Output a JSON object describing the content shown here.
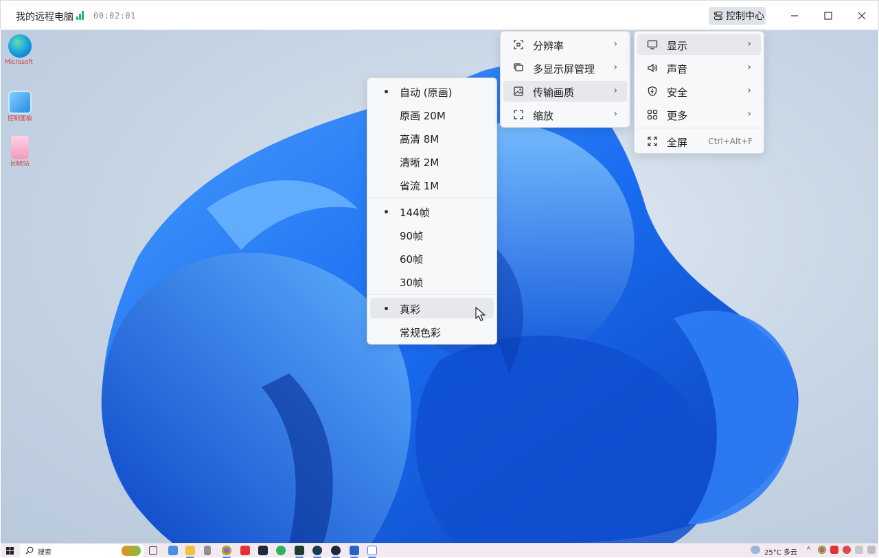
{
  "titlebar": {
    "title": "我的远程电脑",
    "timer": "00:02:01",
    "control_center": "控制中心"
  },
  "desktop_icons": [
    {
      "label": "Microsoft Edge",
      "icon": "edge-icon"
    },
    {
      "label": "控制面板",
      "icon": "control-panel-icon"
    },
    {
      "label": "回收站",
      "icon": "recycle-bin-icon"
    }
  ],
  "main_menu": {
    "items": [
      {
        "label": "显示",
        "icon": "monitor-icon"
      },
      {
        "label": "声音",
        "icon": "speaker-icon"
      },
      {
        "label": "安全",
        "icon": "shield-icon"
      },
      {
        "label": "更多",
        "icon": "grid-icon"
      },
      {
        "label": "全屏",
        "icon": "fullscreen-icon",
        "shortcut": "Ctrl+Alt+F"
      }
    ]
  },
  "display_menu": {
    "items": [
      {
        "label": "分辨率",
        "icon": "resolution-icon"
      },
      {
        "label": "多显示屏管理",
        "icon": "multi-display-icon"
      },
      {
        "label": "传输画质",
        "icon": "image-quality-icon"
      },
      {
        "label": "缩放",
        "icon": "scale-icon"
      }
    ]
  },
  "quality_menu": {
    "quality": [
      "自动 (原画)",
      "原画 20M",
      "高清 8M",
      "清晰 2M",
      "省流 1M"
    ],
    "framerate": [
      "144帧",
      "90帧",
      "60帧",
      "30帧"
    ],
    "color": [
      "真彩",
      "常规色彩"
    ],
    "selected_quality": "自动 (原画)",
    "selected_framerate": "144帧",
    "selected_color": "真彩"
  },
  "taskbar": {
    "search_placeholder": "搜索",
    "weather": "25°C 多云"
  },
  "colors": {
    "signal": "#20b26b",
    "menu_bg": "#f7f8fa",
    "highlight": "#e6e8eb",
    "taskbar": "#f3eaf1"
  }
}
